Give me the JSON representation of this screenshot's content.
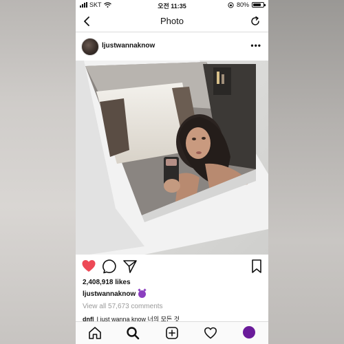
{
  "status_bar": {
    "carrier": "SKT",
    "time": "오전 11:35",
    "battery": "80%",
    "battery_level": 0.8
  },
  "nav": {
    "title": "Photo",
    "back_icon": "chevron-left-icon",
    "refresh_icon": "refresh-icon"
  },
  "post": {
    "username": "ljustwannaknow",
    "more_label": "•••",
    "likes": "2,408,918 likes",
    "caption_user": "ljustwannaknow",
    "view_comments": "View all 57,673 comments",
    "comment_user": "dnfl",
    "comment_text": "I just wanna know 너의 모든 것"
  },
  "actions": [
    "heart-filled-icon",
    "comment-icon",
    "share-icon",
    "bookmark-icon"
  ],
  "colors": {
    "like_red": "#ed4956",
    "profile_purple": "#6a1b9a",
    "devil_emoji": "#8b3fbf"
  },
  "tabs": [
    "home-icon",
    "search-icon",
    "add-icon",
    "activity-icon",
    "profile-icon"
  ]
}
